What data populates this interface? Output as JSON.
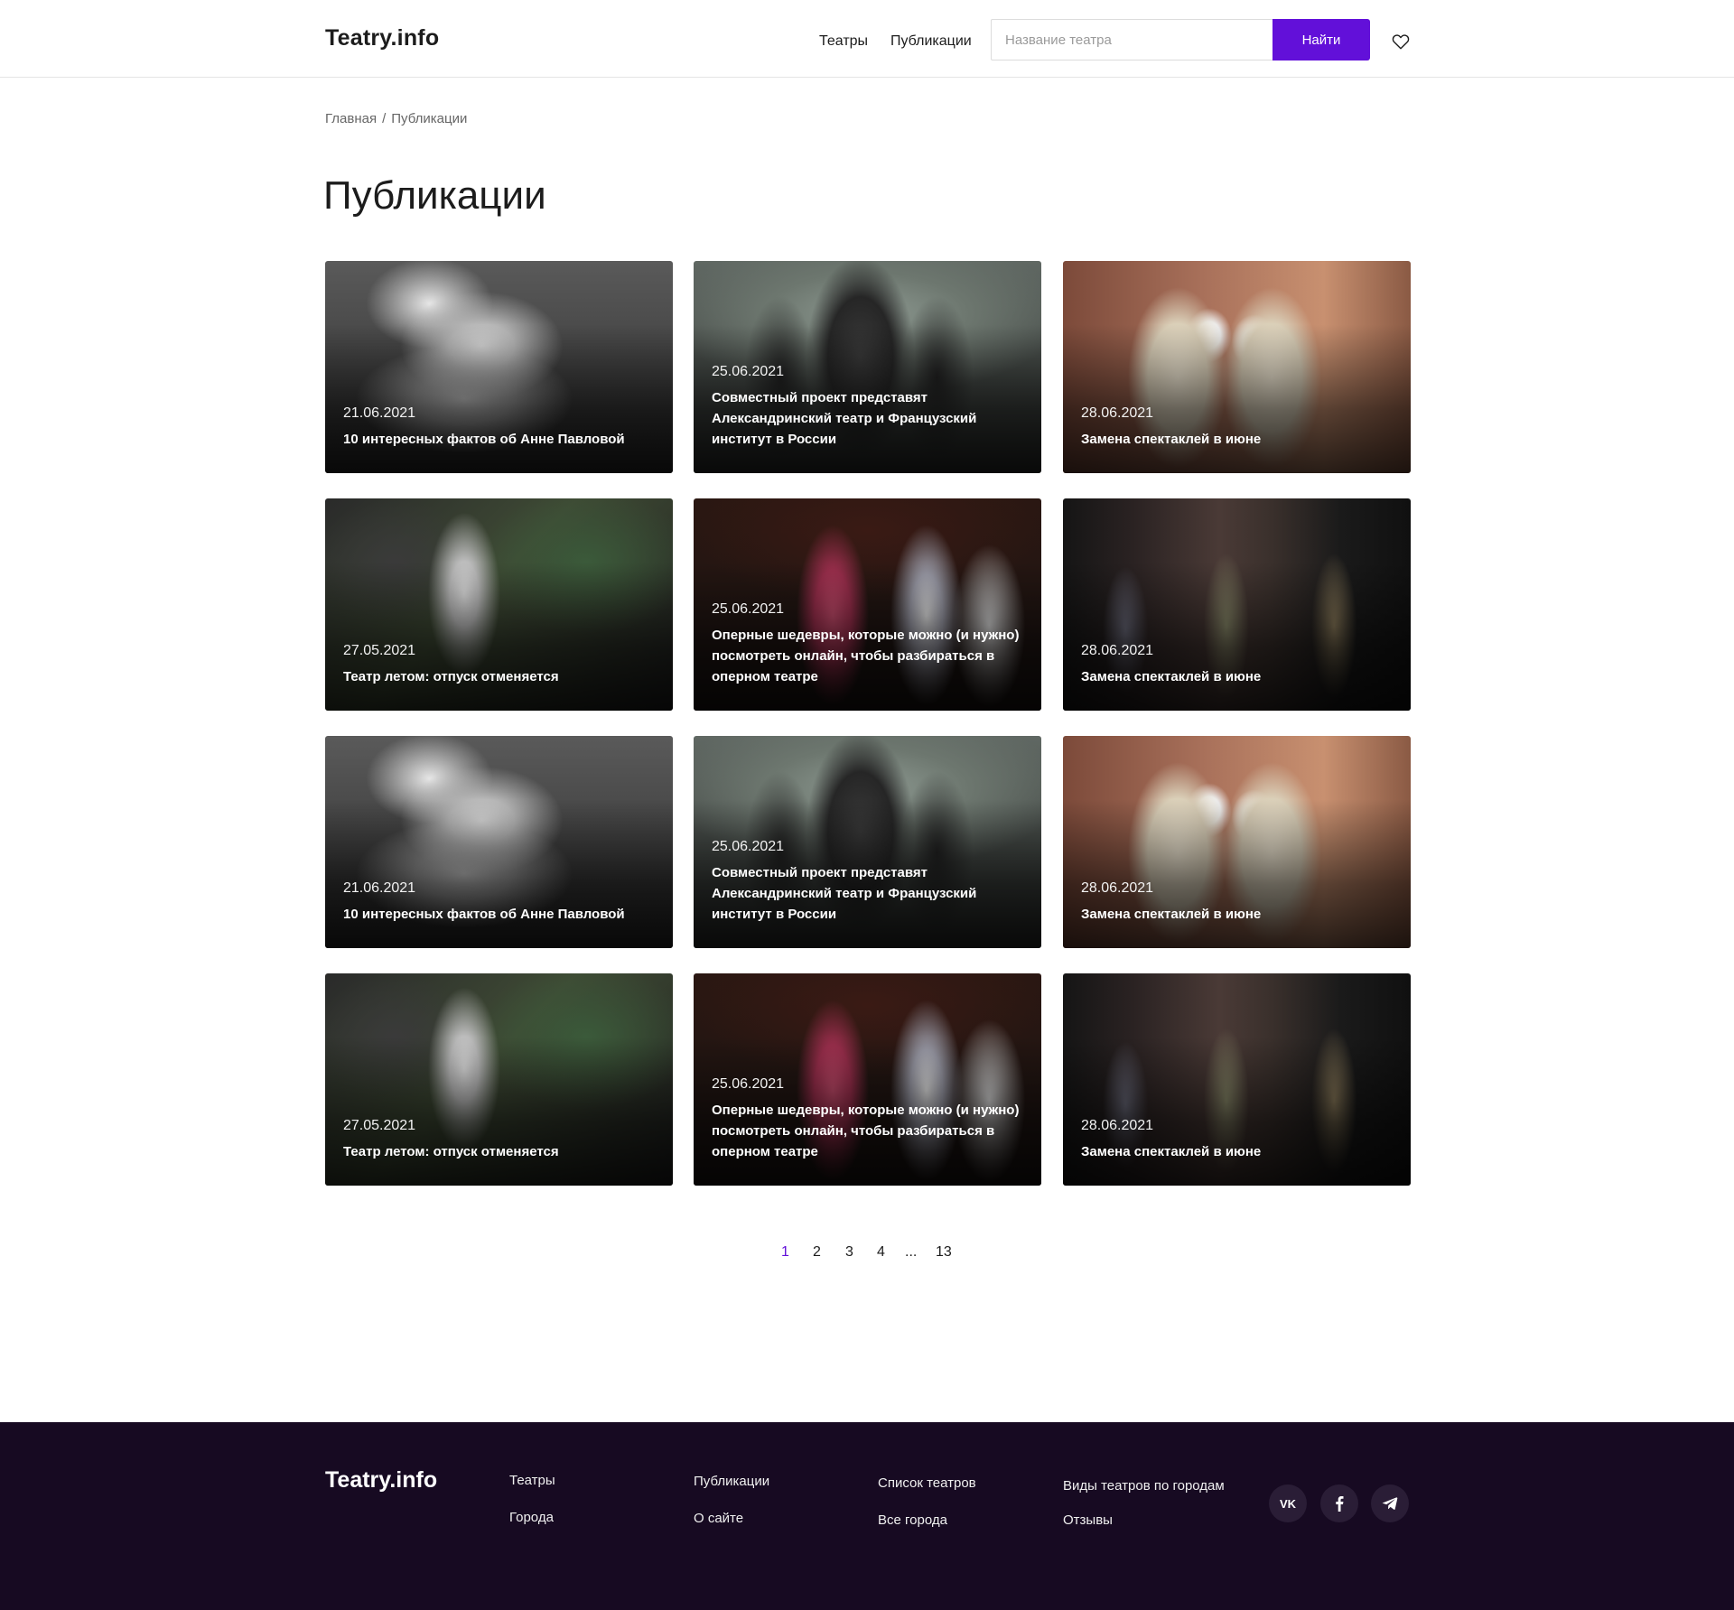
{
  "header": {
    "logo": "Teatry.info",
    "nav": [
      "Театры",
      "Публикации"
    ],
    "search_placeholder": "Название театра",
    "search_button": "Найти",
    "favorites_icon": "heart-icon"
  },
  "breadcrumb": {
    "home": "Главная",
    "separator": "/",
    "current": "Публикации"
  },
  "page_title": "Публикации",
  "cards": [
    {
      "date": "21.06.2021",
      "title": "10 интересных фактов об Анне Павловой"
    },
    {
      "date": "25.06.2021",
      "title": "Совместный проект представят Александринский театр и Французский институт в России"
    },
    {
      "date": "28.06.2021",
      "title": "Замена спектаклей в июне"
    },
    {
      "date": "27.05.2021",
      "title": "Театр летом: отпуск отменяется"
    },
    {
      "date": "25.06.2021",
      "title": "Оперные шедевры, которые можно (и нужно) посмотреть онлайн, чтобы разбираться в оперном театре"
    },
    {
      "date": "28.06.2021",
      "title": "Замена спектаклей в июне"
    },
    {
      "date": "21.06.2021",
      "title": "10 интересных фактов об Анне Павловой"
    },
    {
      "date": "25.06.2021",
      "title": "Совместный проект представят Александринский театр и Французский институт в России"
    },
    {
      "date": "28.06.2021",
      "title": "Замена спектаклей в июне"
    },
    {
      "date": "27.05.2021",
      "title": "Театр летом: отпуск отменяется"
    },
    {
      "date": "25.06.2021",
      "title": "Оперные шедевры, которые можно (и нужно) посмотреть онлайн, чтобы разбираться в оперном театре"
    },
    {
      "date": "28.06.2021",
      "title": "Замена спектаклей в июне"
    }
  ],
  "pagination": {
    "pages": [
      "1",
      "2",
      "3",
      "4",
      "...",
      "13"
    ],
    "active": "1",
    "active_color": "#6210d9"
  },
  "footer": {
    "logo": "Teatry.info",
    "links": [
      [
        "Театры",
        "Города"
      ],
      [
        "Публикации",
        "О сайте"
      ],
      [
        "Список театров",
        "Все города"
      ],
      [
        "Виды театров по городам",
        "Отзывы"
      ]
    ],
    "social": [
      {
        "icon": "vk-icon",
        "label": "VK"
      },
      {
        "icon": "facebook-icon",
        "label": "f"
      },
      {
        "icon": "telegram-icon",
        "label": ""
      }
    ],
    "background": "#170a22"
  },
  "colors": {
    "accent": "#6210d9"
  }
}
